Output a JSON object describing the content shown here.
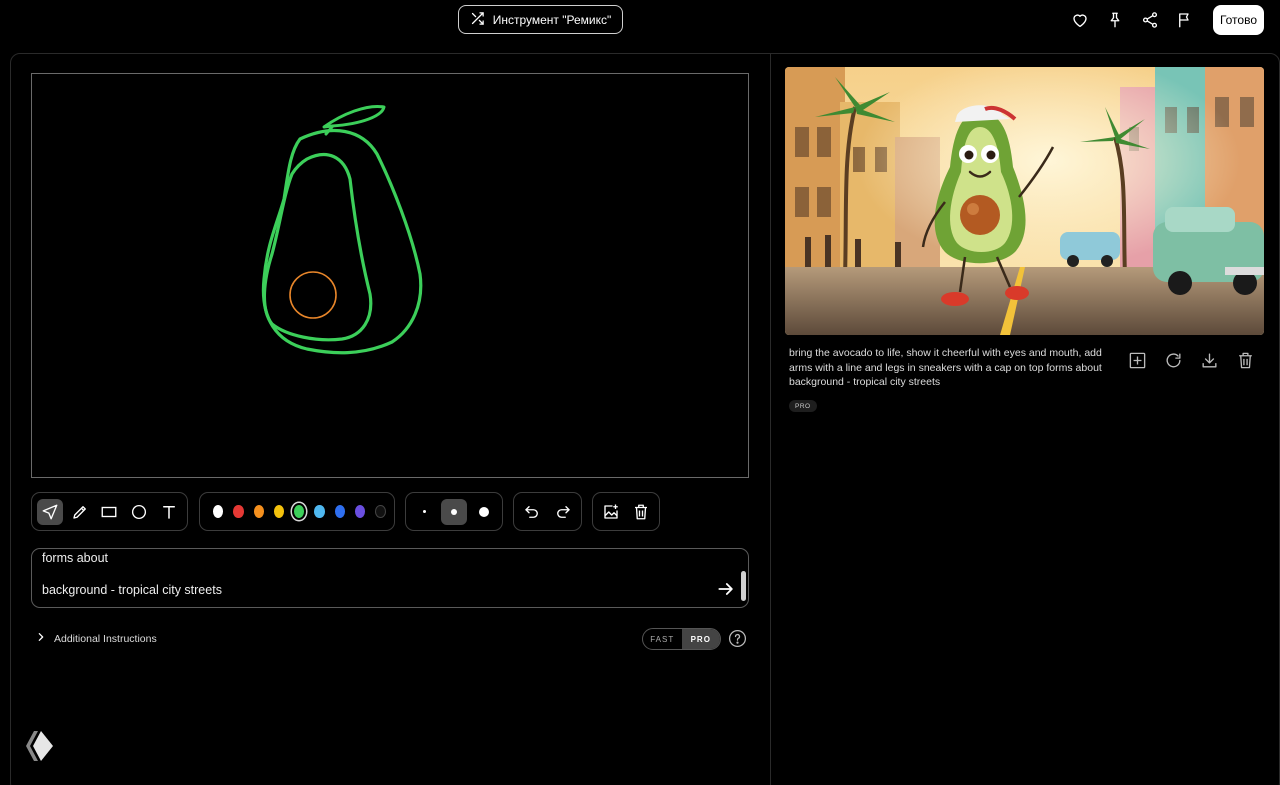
{
  "header": {
    "remix_tool_label": "Инструмент \"Ремикс\"",
    "done_label": "Готово",
    "icons": [
      "heart-icon",
      "pin-icon",
      "share-icon",
      "flag-icon"
    ]
  },
  "toolbar": {
    "tools": [
      "select-arrow-icon",
      "pencil-icon",
      "rectangle-icon",
      "circle-icon",
      "text-icon"
    ],
    "active_tool": "select-arrow-icon",
    "colors": [
      "#ffffff",
      "#e53935",
      "#f5901e",
      "#f4c20d",
      "#3ccf5a",
      "#4fb8f0",
      "#2f6ff0",
      "#6a4fe0",
      "#111111"
    ],
    "selected_color": "#3ccf5a",
    "brush_sizes": [
      "small",
      "medium",
      "large"
    ],
    "selected_brush_size": "medium",
    "history": [
      "undo-icon",
      "redo-icon"
    ],
    "extra": [
      "add-image-icon",
      "trash-icon"
    ]
  },
  "prompt": {
    "text": "forms about\n\nbackground - tropical city streets"
  },
  "additional_instructions": {
    "label": "Additional Instructions"
  },
  "mode": {
    "fast_label": "FAST",
    "pro_label": "PRO",
    "selected": "PRO"
  },
  "result": {
    "caption": "bring the avocado to life, show it cheerful with eyes and mouth, add arms with a line and legs in sneakers with a cap on top forms about background - tropical city streets",
    "badge": "PRO",
    "actions": [
      "add-icon",
      "regenerate-icon",
      "download-icon",
      "trash-icon"
    ]
  },
  "colors": {
    "stroke_green": "#3ccf5a",
    "stroke_orange": "#e8862a",
    "background": "#000000"
  }
}
